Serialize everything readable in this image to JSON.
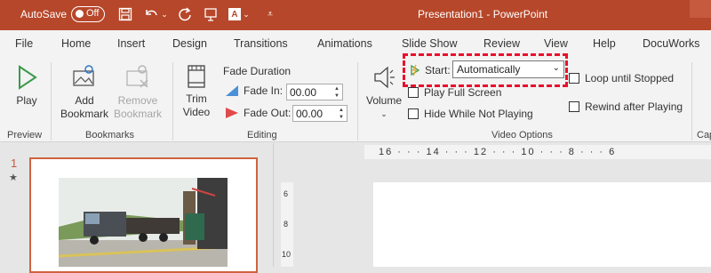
{
  "titlebar": {
    "autosave_label": "AutoSave",
    "autosave_state": "Off",
    "title": "Presentation1  -  PowerPoint",
    "icons": [
      "save-icon",
      "undo-icon",
      "redo-icon",
      "present-icon",
      "font-icon",
      "customize-icon"
    ]
  },
  "tabs": [
    "File",
    "Home",
    "Insert",
    "Design",
    "Transitions",
    "Animations",
    "Slide Show",
    "Review",
    "View",
    "Help",
    "DocuWorks"
  ],
  "ribbon": {
    "preview": {
      "play_label": "Play",
      "group_label": "Preview"
    },
    "bookmarks": {
      "add_line1": "Add",
      "add_line2": "Bookmark",
      "remove_line1": "Remove",
      "remove_line2": "Bookmark",
      "group_label": "Bookmarks"
    },
    "editing": {
      "trim_line1": "Trim",
      "trim_line2": "Video",
      "fade_duration": "Fade Duration",
      "fade_in_label": "Fade In:",
      "fade_in_value": "00.00",
      "fade_out_label": "Fade Out:",
      "fade_out_value": "00.00",
      "group_label": "Editing"
    },
    "video_options": {
      "volume_label": "Volume",
      "start_label": "Start:",
      "start_value": "Automatically",
      "play_full_screen": "Play Full Screen",
      "hide_while_not_playing": "Hide While Not Playing",
      "loop_until_stopped": "Loop until Stopped",
      "rewind_after_playing": "Rewind after Playing",
      "group_label": "Video Options"
    },
    "cut_group_label": "Cap"
  },
  "slides": {
    "number": "1",
    "star": "★"
  },
  "ruler": {
    "h_ticks": "16 · · · 14 · · · 12 · · · 10 · · · 8 · · · 6",
    "v_ticks": [
      "6",
      "8",
      "10"
    ]
  },
  "colors": {
    "accent": "#b7472a",
    "highlight": "#e8112d",
    "ribbon_bg": "#f3f3f3"
  }
}
